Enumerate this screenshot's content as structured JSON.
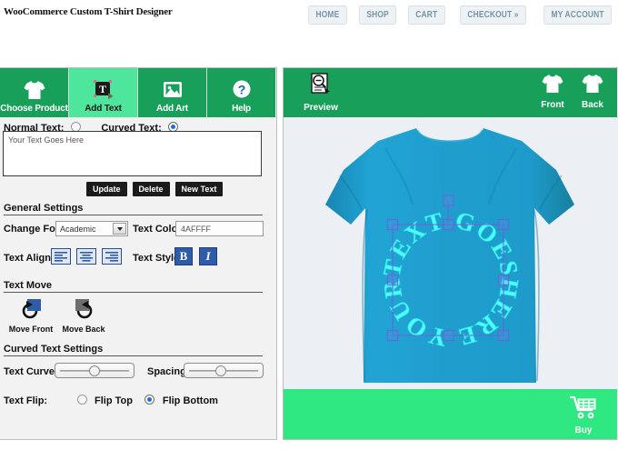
{
  "header": {
    "title": "WooCommerce Custom T-Shirt Designer",
    "nav": [
      {
        "label": "HOME",
        "name": "nav-home"
      },
      {
        "label": "SHOP",
        "name": "nav-shop"
      },
      {
        "label": "CART",
        "name": "nav-cart"
      },
      {
        "label": "CHECKOUT »",
        "name": "nav-checkout"
      },
      {
        "label": "MY ACCOUNT",
        "name": "nav-my-account"
      }
    ]
  },
  "tabs": [
    {
      "label": "Choose Product",
      "icon": "tshirt-icon",
      "active": false
    },
    {
      "label": "Add Text",
      "icon": "text-box-icon",
      "active": true
    },
    {
      "label": "Add Art",
      "icon": "image-frame-icon",
      "active": false
    },
    {
      "label": "Help",
      "icon": "question-mark-icon",
      "active": false
    }
  ],
  "text_mode": {
    "normal_label": "Normal Text:",
    "curved_label": "Curved Text:",
    "selected": "curved"
  },
  "editor": {
    "textarea_value": "Your Text Goes Here",
    "textarea_placeholder": "Your Text Goes Here",
    "buttons": [
      {
        "label": "Update",
        "name": "update-button"
      },
      {
        "label": "Delete",
        "name": "delete-button"
      },
      {
        "label": "New Text",
        "name": "new-text-button"
      }
    ]
  },
  "general_settings": {
    "title": "General Settings",
    "change_font_label": "Change Font",
    "font_value": "Academic",
    "text_color_label": "Text Color:",
    "text_color_value": "4AFFFF",
    "text_align_label": "Text Align:",
    "text_style_label": "Text Style:",
    "bold_label": "B",
    "italic_label": "I"
  },
  "text_move": {
    "title": "Text Move",
    "move_front_label": "Move Front",
    "move_back_label": "Move Back"
  },
  "curved_settings": {
    "title": "Curved Text Settings",
    "text_curved_label": "Text Curved:",
    "text_curved_value": 48,
    "spacing_label": "Spacing:",
    "spacing_value": 44,
    "text_flip_label": "Text Flip:",
    "flip_top_label": "Flip Top",
    "flip_bottom_label": "Flip Bottom",
    "flip_selected": "bottom"
  },
  "canvas": {
    "preview_label": "Preview",
    "front_label": "Front",
    "back_label": "Back",
    "buy_label": "Buy",
    "shirt_color": "#1e9bcc",
    "design_text": "TEXT GOES HERE YOUR",
    "design_text_color": "#4AFFFF",
    "design_words": [
      "TEXT",
      "GOES",
      "HERE",
      "YOUR"
    ]
  },
  "colors": {
    "brand_green": "#18a05a",
    "active_tab_green": "#4ee59c",
    "bottom_bar_green": "#2fe881",
    "title_blue": "#4a7ba7",
    "accent_blue": "#2f5ca8",
    "selection_purple": "#6a63d8"
  }
}
